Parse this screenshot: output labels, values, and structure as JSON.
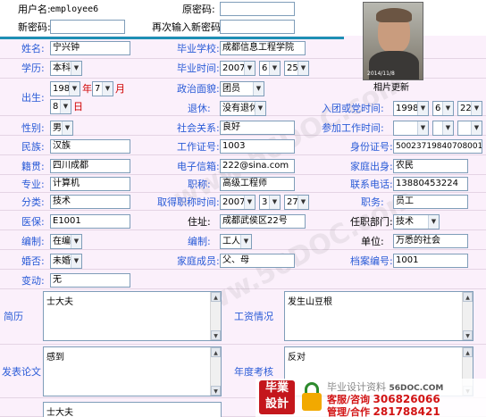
{
  "top": {
    "username_label": "用户名:",
    "username_value": "employee6",
    "old_password_label": "原密码:",
    "new_password_label": "新密码:",
    "confirm_password_label": "再次输入新密码:"
  },
  "photo": {
    "caption_date": "2014/11/8",
    "update_label": "相片更新"
  },
  "fields": {
    "name_label": "姓名:",
    "name_value": "宁兴钟",
    "school_label": "毕业学校:",
    "school_value": "成都信息工程学院",
    "education_label": "学历:",
    "education_value": "本科",
    "grad_time_label": "毕业时间:",
    "grad_year": "2007",
    "grad_month": "6",
    "grad_day": "25",
    "birth_label": "出生:",
    "birth_year": "1984",
    "birth_year_unit": "年",
    "birth_month": "7",
    "birth_month_unit": "月",
    "birth_day": "8",
    "birth_day_unit": "日",
    "political_label": "政治面貌:",
    "political_value": "团员",
    "retire_label": "退休:",
    "retire_value": "没有退休",
    "party_time_label": "入团或党时间:",
    "party_year": "1998",
    "party_month": "6",
    "party_day": "22",
    "gender_label": "性别:",
    "gender_value": "男",
    "social_label": "社会关系:",
    "social_value": "良好",
    "work_time_label": "参加工作时间:",
    "ethnic_label": "民族:",
    "ethnic_value": "汉族",
    "work_id_label": "工作证号:",
    "work_id_value": "1003",
    "id_card_label": "身份证号:",
    "id_card_value": "500237198407080014",
    "native_label": "籍贯:",
    "native_value": "四川成都",
    "email_label": "电子信箱:",
    "email_value": "222@sina.com",
    "origin_label": "家庭出身:",
    "origin_value": "农民",
    "major_label": "专业:",
    "major_value": "计算机",
    "title_label": "职称:",
    "title_value": "高级工程师",
    "phone_label": "联系电话:",
    "phone_value": "13880453224",
    "category_label": "分类:",
    "category_value": "技术",
    "title_time_label": "取得职称时间:",
    "title_year": "2007",
    "title_month": "3",
    "title_day": "27",
    "position_label": "职务:",
    "position_value": "员工",
    "medical_label": "医保:",
    "medical_value": "E1001",
    "address_label": "住址:",
    "address_value": "成都武侯区22号",
    "dept_label": "任职部门:",
    "dept_value": "技术",
    "staffing_label": "编制:",
    "staffing_value": "在编",
    "staffing2_label": "编制:",
    "staffing2_value": "工人",
    "unit_label": "单位:",
    "unit_value": "万悉的社会",
    "marital_label": "婚否:",
    "marital_value": "未婚",
    "family_label": "家庭成员:",
    "family_value": "父、母",
    "archive_label": "档案编号:",
    "archive_value": "1001",
    "change_label": "变动:",
    "change_value": "无"
  },
  "areas": {
    "resume_label": "简历",
    "resume_value": "士大夫",
    "wage_label": "工资情况",
    "wage_value": "发生山豆根",
    "paper_label": "发表论文",
    "paper_value": "感到",
    "review_label": "年度考核",
    "review_value": "反对",
    "extra_value": "士大夫"
  },
  "watermark": {
    "text": "www.56DOC.com"
  },
  "banner": {
    "logo_line1": "毕業",
    "logo_line2": "設計",
    "site_text": "毕业设计资料",
    "site_domain": "56DOC.COM",
    "service_label": "客服/咨询",
    "service_number": "306826066",
    "admin_label": "管理/合作",
    "admin_number": "281788421"
  },
  "colors": {
    "label_blue": "#2a5bd7",
    "divider": "#1e8fb4",
    "row_bg": "#fbf0fb"
  }
}
